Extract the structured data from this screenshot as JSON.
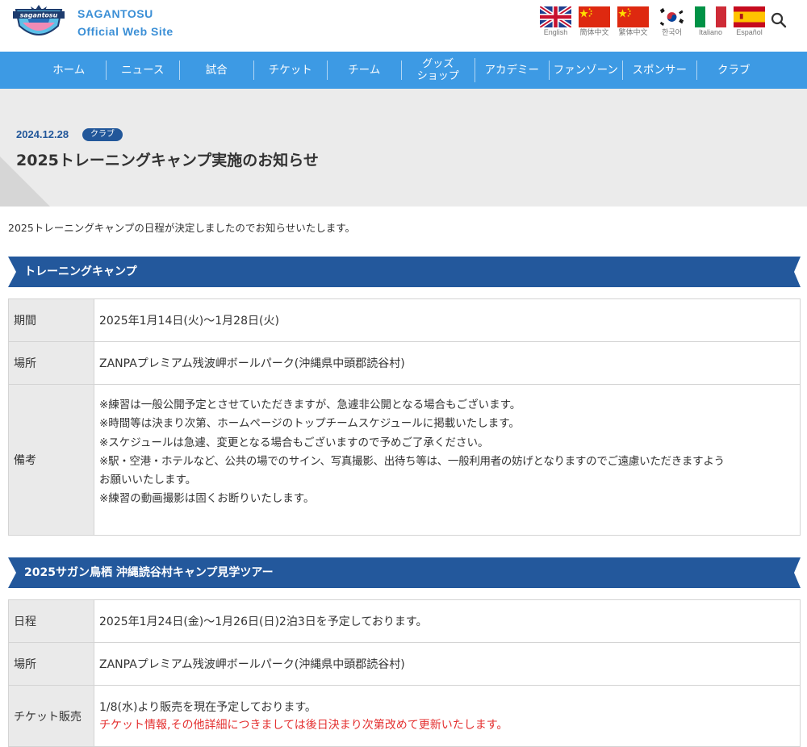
{
  "header": {
    "logo_text": "sagantosu",
    "site_name": "SAGANTOSU",
    "site_subtitle": "Official Web Site",
    "languages": [
      {
        "label": "English",
        "icon": "uk-flag-icon"
      },
      {
        "label": "簡体中文",
        "icon": "china-flag-icon"
      },
      {
        "label": "繁体中文",
        "icon": "china-flag-icon"
      },
      {
        "label": "한국어",
        "icon": "korea-flag-icon"
      },
      {
        "label": "Italiano",
        "icon": "italy-flag-icon"
      },
      {
        "label": "Español",
        "icon": "spain-flag-icon"
      }
    ]
  },
  "nav": {
    "items": [
      "ホーム",
      "ニュース",
      "試合",
      "チケット",
      "チーム",
      "グッズ\nショップ",
      "アカデミー",
      "ファンゾーン",
      "スポンサー",
      "クラブ"
    ]
  },
  "post": {
    "date": "2024.12.28",
    "category": "クラブ",
    "title": "2025トレーニングキャンプ実施のお知らせ",
    "intro": "2025トレーニングキャンプの日程が決定しましたのでお知らせいたします。"
  },
  "section1": {
    "heading": "トレーニングキャンプ",
    "rows": [
      {
        "label": "期間",
        "value": "2025年1月14日(火)〜1月28日(火)"
      },
      {
        "label": "場所",
        "value": "ZANPAプレミアム残波岬ボールパーク(沖縄県中頭郡読谷村)"
      }
    ],
    "remarks_label": "備考",
    "remarks": [
      "※練習は一般公開予定とさせていただきますが、急遽非公開となる場合もございます。",
      "※時間等は決まり次第、ホームページのトップチームスケジュールに掲載いたします。",
      "※スケジュールは急遽、変更となる場合もございますので予めご了承ください。",
      "※駅・空港・ホテルなど、公共の場でのサイン、写真撮影、出待ち等は、一般利用者の妨げとなりますのでご遠慮いただきますよう",
      "お願いいたします。",
      "※練習の動画撮影は固くお断りいたします。"
    ]
  },
  "section2": {
    "heading": "2025サガン鳥栖 沖縄読谷村キャンプ見学ツアー",
    "rows": [
      {
        "label": "日程",
        "value": "2025年1月24日(金)〜1月26日(日)2泊3日を予定しております。"
      },
      {
        "label": "場所",
        "value": "ZANPAプレミアム残波岬ボールパーク(沖縄県中頭郡読谷村)"
      }
    ],
    "ticket_label": "チケット販売",
    "ticket_line1": "1/8(水)より販売を現在予定しております。",
    "ticket_line2": "チケット情報,その他詳細につきましては後日決まり次第改めて更新いたします。"
  },
  "colors": {
    "nav_bg": "#3d9ae4",
    "section_bg": "#23589c",
    "accent_red": "#e43030",
    "site_name": "#3b8fd6"
  }
}
